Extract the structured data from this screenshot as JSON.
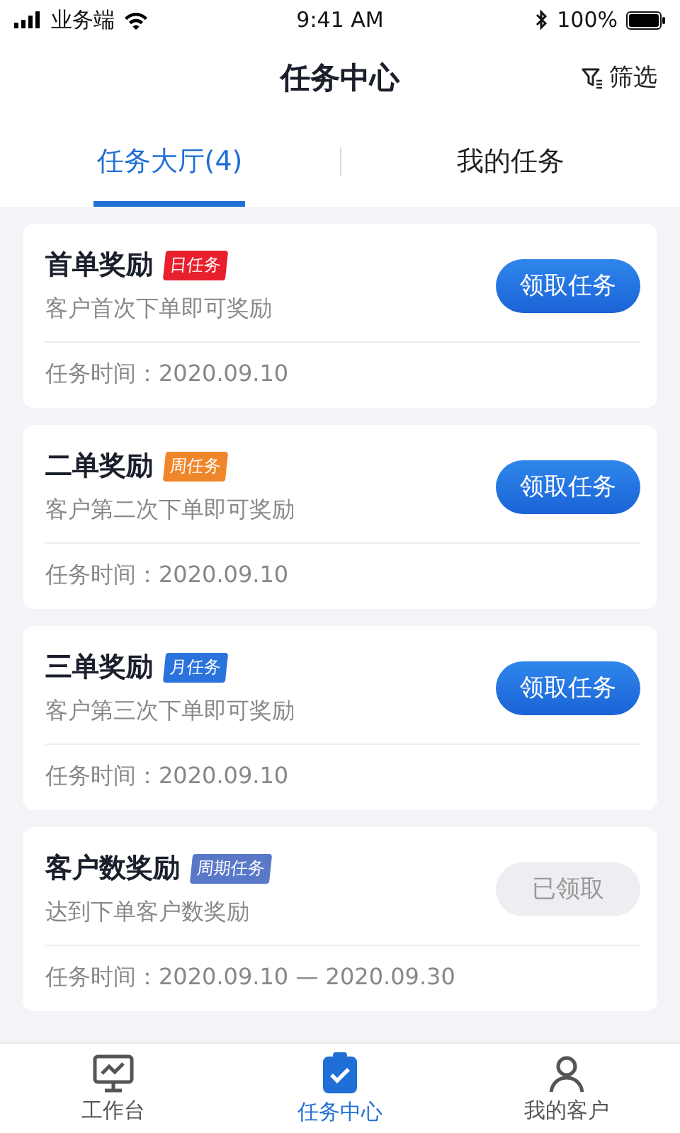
{
  "status_bar": {
    "carrier": "业务端",
    "time": "9:41 AM",
    "battery": "100%"
  },
  "header": {
    "title": "任务中心",
    "filter": "筛选"
  },
  "tabs": [
    {
      "label": "任务大厅(4)",
      "selected": true
    },
    {
      "label": "我的任务",
      "selected": false
    }
  ],
  "tasks": [
    {
      "title": "首单奖励",
      "tag": "日任务",
      "color": "#e8202e",
      "description": "客户首次下单即可奖励",
      "time": "任务时间：2020.09.10",
      "action": "领取任务",
      "claimed": false
    },
    {
      "title": "二单奖励",
      "tag": "周任务",
      "color": "#f0862a",
      "description": "客户第二次下单即可奖励",
      "time": "任务时间：2020.09.10",
      "action": "领取任务",
      "claimed": false
    },
    {
      "title": "三单奖励",
      "tag": "月任务",
      "color": "#2a72dc",
      "description": "客户第三次下单即可奖励",
      "time": "任务时间：2020.09.10",
      "action": "领取任务",
      "claimed": false
    },
    {
      "title": "客户数奖励",
      "tag": "周期任务",
      "color": "#5a78c8",
      "description": "达到下单客户数奖励",
      "time": "任务时间：2020.09.10 — 2020.09.30",
      "action": "已领取",
      "claimed": true
    }
  ],
  "bottom_nav": [
    {
      "label": "工作台",
      "kind": "monitor",
      "selected": false
    },
    {
      "label": "任务中心",
      "kind": "clipboard",
      "selected": true
    },
    {
      "label": "我的客户",
      "kind": "person",
      "selected": false
    }
  ]
}
